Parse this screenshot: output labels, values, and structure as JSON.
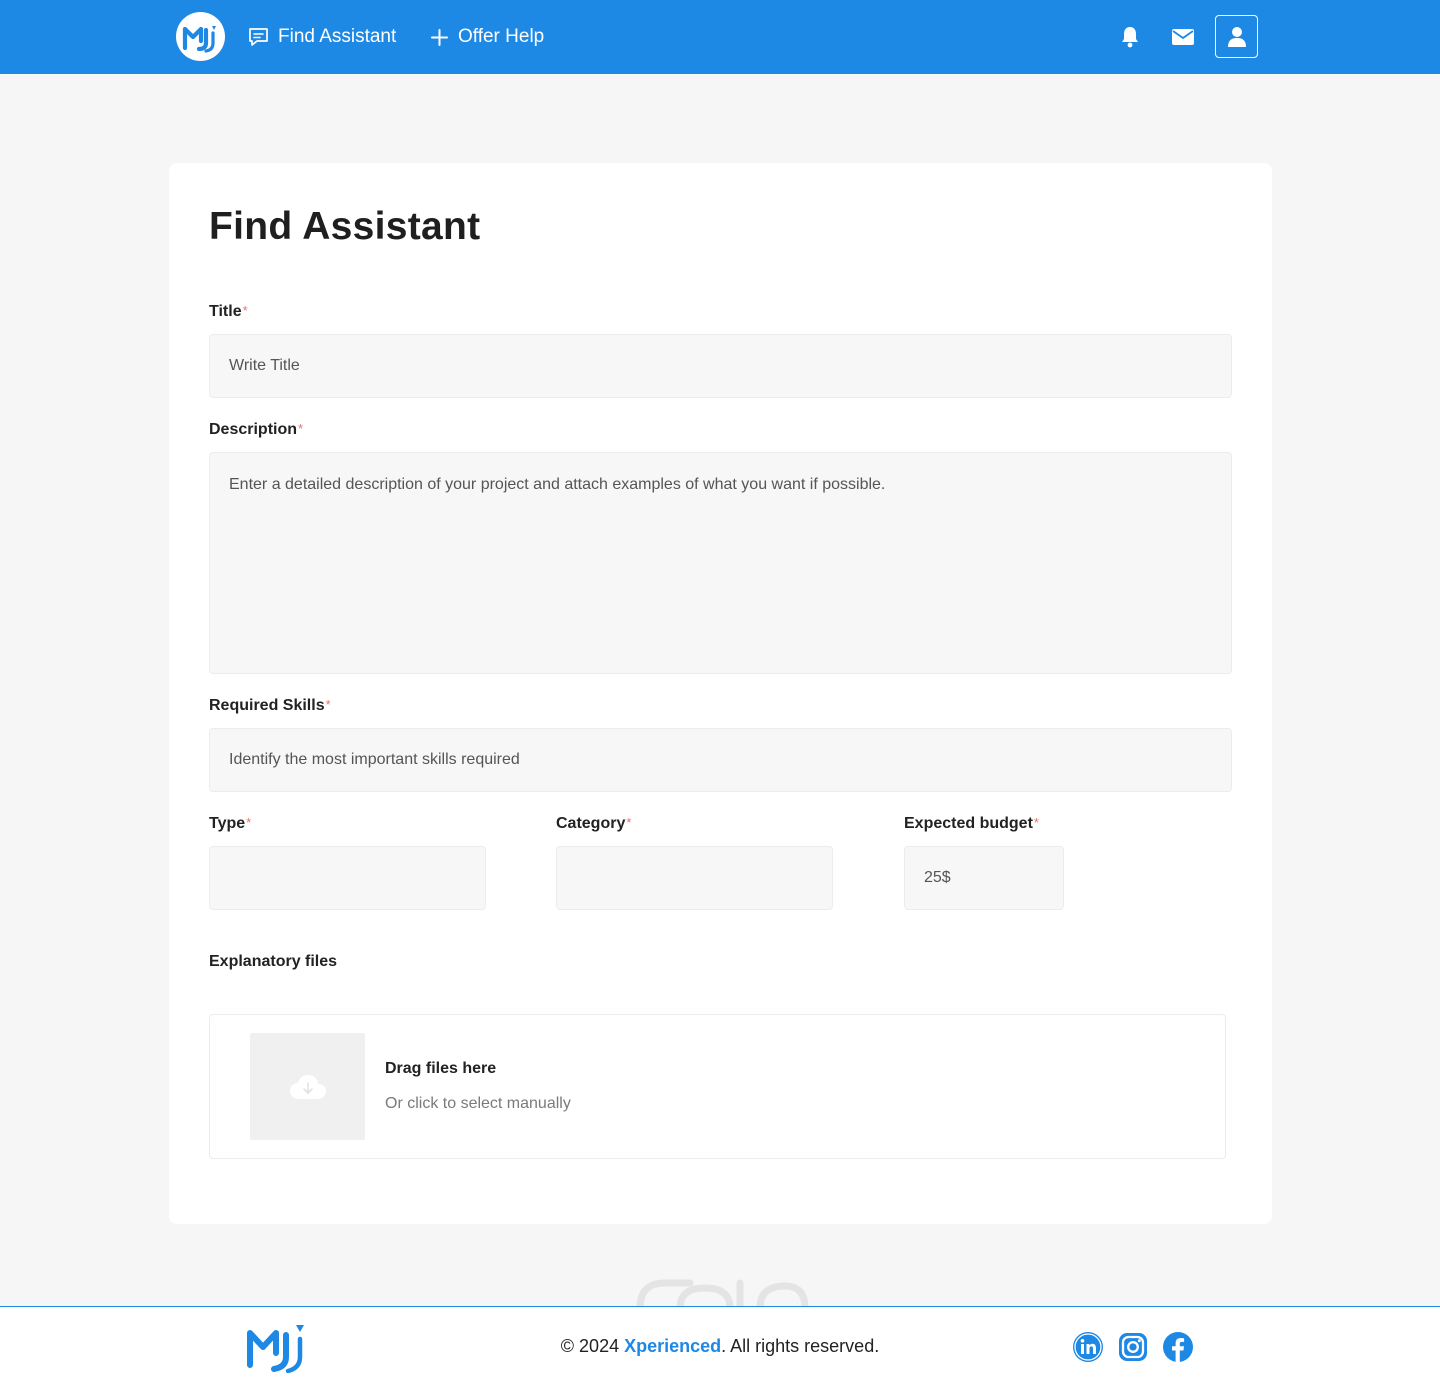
{
  "nav": {
    "find_assistant": "Find Assistant",
    "offer_help": "Offer Help"
  },
  "form": {
    "heading": "Find Assistant",
    "required_marker": "*",
    "title_label": "Title",
    "title_placeholder": "Write Title",
    "description_label": "Description",
    "description_placeholder": "Enter a detailed description of your project and attach examples of what you want if possible.",
    "skills_label": "Required Skills",
    "skills_placeholder": "Identify the most important skills required",
    "type_label": "Type",
    "type_value": "",
    "category_label": "Category",
    "category_value": "",
    "budget_label": "Expected budget",
    "budget_value": "25$",
    "files_label": "Explanatory files",
    "drop_title": "Drag files here",
    "drop_subtitle": "Or click to select manually"
  },
  "footer": {
    "copyright_prefix": "© 2024 ",
    "brand": "Xperienced",
    "copyright_suffix": ". All rights reserved."
  },
  "icons": {
    "nav_find": "chat-bubble-icon",
    "nav_offer": "plus-icon",
    "notifications": "bell-icon",
    "messages": "mail-icon",
    "profile": "user-icon",
    "upload": "cloud-download-icon",
    "social": [
      "linkedin-icon",
      "instagram-icon",
      "facebook-icon"
    ]
  },
  "colors": {
    "primary": "#1e88e5",
    "background": "#f6f6f6",
    "required": "#e57373",
    "field_bg": "#f7f7f7"
  }
}
